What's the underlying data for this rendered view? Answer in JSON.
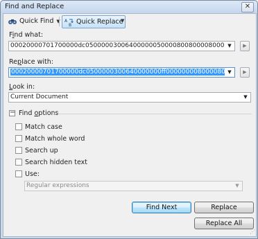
{
  "window": {
    "title": "Find and Replace",
    "close_glyph": "✕"
  },
  "toolbar": {
    "quick_find": "Quick Find",
    "quick_replace": "Quick Replace",
    "quick_find_icon": "binoculars-icon",
    "quick_replace_icon": "replace-icon"
  },
  "find": {
    "label_pre": "F",
    "label_key": "i",
    "label_post": "nd what:",
    "value": "00020000701700000dc050000030064000000500008008000080000000002a00"
  },
  "replace": {
    "label_pre": "Re",
    "label_key": "p",
    "label_post": "lace with:",
    "value": "00020000701700000dc0500000300640000000ff00000000800008000000000011a00"
  },
  "look_in": {
    "label_pre": "",
    "label_key": "L",
    "label_post": "ook in:",
    "value": "Current Document"
  },
  "find_options": {
    "label_pre": "Find ",
    "label_key": "o",
    "label_post": "ptions",
    "expander_glyph": "−",
    "match_case": "Match case",
    "match_whole_word": "Match whole word",
    "search_up": "Search up",
    "search_hidden": "Search hidden text",
    "use": "Use:",
    "use_value": "Regular expressions"
  },
  "buttons": {
    "find_next": "Find Next",
    "replace": "Replace",
    "replace_all": "Replace All"
  },
  "colors": {
    "selection": "#3399ff",
    "window_frame": "#c9d9ec",
    "client_bg": "#f0f0f0"
  }
}
